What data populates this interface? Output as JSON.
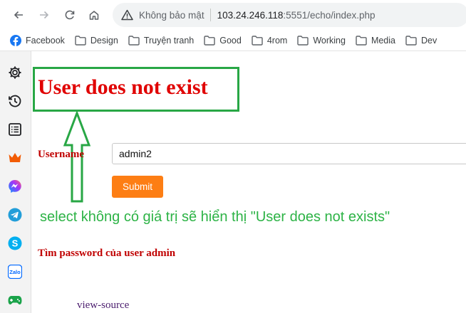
{
  "browser": {
    "security_label": "Không bảo mật",
    "url_host": "103.24.246.118",
    "url_path": ":5551/echo/index.php"
  },
  "bookmarks": [
    {
      "label": "Facebook",
      "icon": "facebook-icon"
    },
    {
      "label": "Design",
      "icon": "folder-icon"
    },
    {
      "label": "Truyện tranh",
      "icon": "folder-icon"
    },
    {
      "label": "Good",
      "icon": "folder-icon"
    },
    {
      "label": "4rom",
      "icon": "folder-icon"
    },
    {
      "label": "Working",
      "icon": "folder-icon"
    },
    {
      "label": "Media",
      "icon": "folder-icon"
    },
    {
      "label": "Dev",
      "icon": "folder-icon"
    }
  ],
  "sidebar": {
    "icons": [
      "gear-icon",
      "history-icon",
      "reading-list-icon",
      "crown-icon",
      "messenger-icon",
      "telegram-icon",
      "skype-icon",
      "zalo-icon",
      "gamepad-icon"
    ]
  },
  "page": {
    "message": "User does not exist",
    "username_label": "Username",
    "username_value": "admin2",
    "submit_label": "Submit",
    "annotation": "select không có giá trị sẽ hiển thị \"User does not exists\"",
    "hint": "Tìm password của user admin",
    "view_source": "view-source"
  },
  "colors": {
    "message": "#e00000",
    "annotation": "#2db346",
    "submit": "#fd7e14"
  }
}
